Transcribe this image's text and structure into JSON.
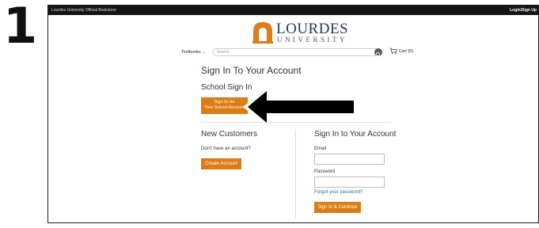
{
  "step": {
    "number": "1"
  },
  "topbar": {
    "store_name": "Lourdes University Official Bookstore",
    "login_label": "Login/Sign Up"
  },
  "logo": {
    "word": "LOURDES",
    "sub": "UNIVERSITY"
  },
  "nav": {
    "textbooks_label": "Textbooks",
    "search_placeholder": "Search",
    "cart_label": "Cart (0)"
  },
  "main": {
    "title": "Sign In To Your Account",
    "school_heading": "School Sign In",
    "school_button_line1": "Sign In via",
    "school_button_line2": "Your School Account"
  },
  "new_customers": {
    "title": "New Customers",
    "text": "Don't have an account?",
    "create_button": "Create Account"
  },
  "signin": {
    "title": "Sign In to Your Account",
    "email_label": "Email",
    "password_label": "Password",
    "forgot_link": "Forgot your password?",
    "continue_button": "Sign In & Continue"
  },
  "colors": {
    "accent": "#de7b12",
    "topbar": "#141414",
    "link": "#2b6aa8"
  },
  "icons": [
    "chevron-down-icon",
    "search-icon",
    "cart-icon",
    "arrow-pointer-icon",
    "lourdes-arch-logo"
  ]
}
